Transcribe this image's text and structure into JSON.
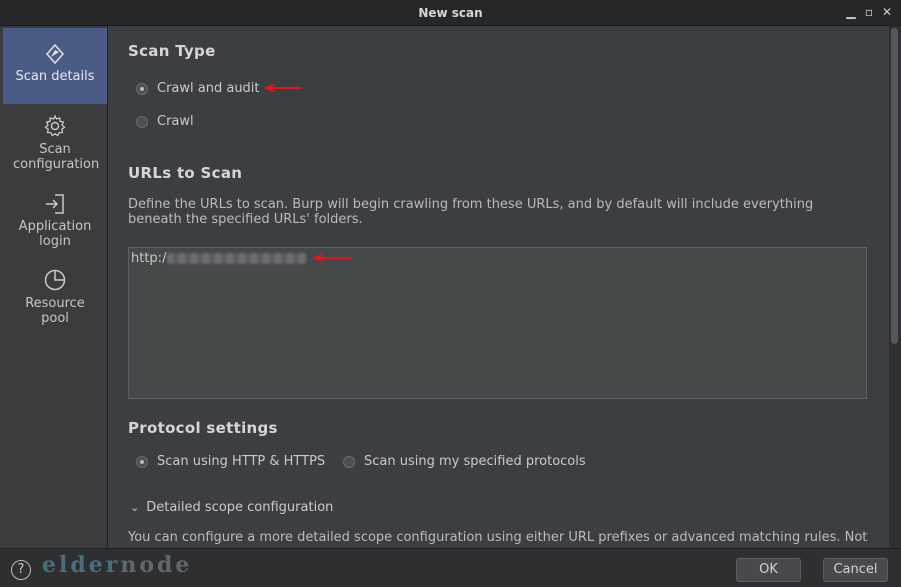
{
  "window": {
    "title": "New scan"
  },
  "sidebar": {
    "items": [
      {
        "label": "Scan details",
        "icon": "compass-icon",
        "active": true
      },
      {
        "label": "Scan configuration",
        "icon": "gear-icon",
        "active": false
      },
      {
        "label": "Application login",
        "icon": "login-icon",
        "active": false
      },
      {
        "label": "Resource pool",
        "icon": "pie-chart-icon",
        "active": false
      }
    ]
  },
  "scan_type": {
    "heading": "Scan Type",
    "options": [
      {
        "label": "Crawl and audit",
        "selected": true
      },
      {
        "label": "Crawl",
        "selected": false
      }
    ]
  },
  "urls": {
    "heading": "URLs to Scan",
    "description": "Define the URLs to scan. Burp will begin crawling from these URLs, and by default will include everything beneath the specified URLs' folders.",
    "value": "http:/"
  },
  "protocol": {
    "heading": "Protocol settings",
    "options": [
      {
        "label": "Scan using HTTP & HTTPS",
        "selected": true
      },
      {
        "label": "Scan using my specified protocols",
        "selected": false
      }
    ],
    "detailed_toggle": "Detailed scope configuration",
    "detailed_description": "You can configure a more detailed scope configuration using either URL prefixes or advanced matching rules. Note"
  },
  "footer": {
    "help": "?",
    "ok": "OK",
    "cancel": "Cancel",
    "watermark_a": "elder",
    "watermark_b": "node"
  },
  "colors": {
    "accent": "#4a5c86",
    "annotation": "#e8141c"
  }
}
